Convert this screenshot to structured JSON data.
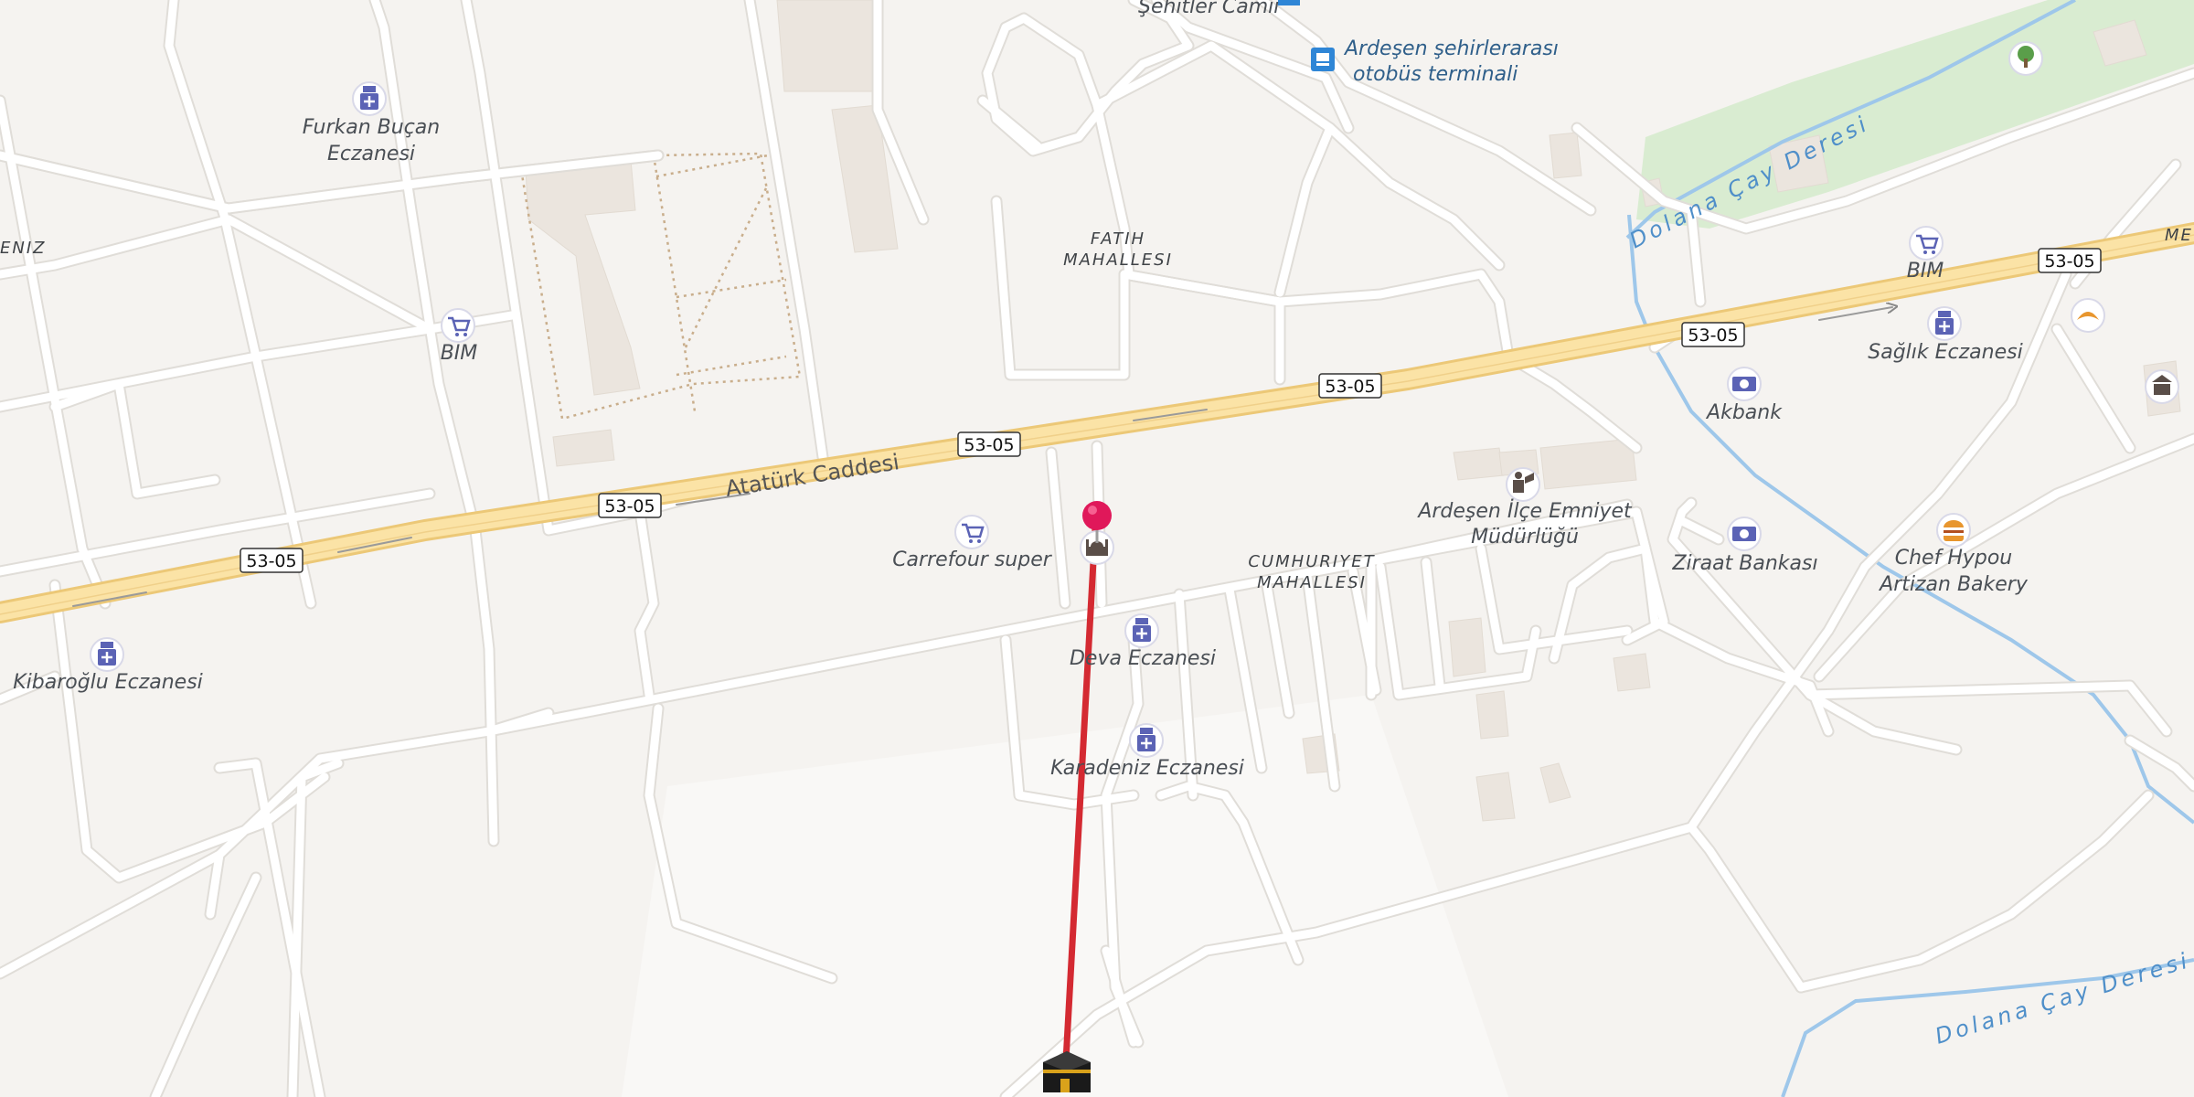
{
  "map": {
    "road_shields": [
      "53-05",
      "53-05",
      "53-05",
      "53-05",
      "53-05",
      "53-05"
    ],
    "streets": [
      "Atatürk Caddesi"
    ],
    "districts": [
      {
        "line1": "FATIH",
        "line2": "MAHALLESI"
      },
      {
        "line1": "CUMHURIYET",
        "line2": "MAHALLESI"
      },
      {
        "line1": "ENIZ",
        "line2": ""
      },
      {
        "line1": "ME",
        "line2": ""
      }
    ],
    "waterways": [
      "Dolana Çay Deresi",
      "Dolana Çay Deresi"
    ],
    "pois": [
      {
        "icon": "pharmacy-icon",
        "line1": "Furkan Buçan",
        "line2": "Eczanesi"
      },
      {
        "icon": "shopping-cart-icon",
        "line1": "BIM",
        "line2": ""
      },
      {
        "icon": "pharmacy-icon",
        "line1": "Kibaroğlu Eczanesi",
        "line2": ""
      },
      {
        "icon": "shopping-cart-icon",
        "line1": "Carrefour super",
        "line2": ""
      },
      {
        "icon": "mosque-icon",
        "line1": "",
        "line2": ""
      },
      {
        "icon": "pharmacy-icon",
        "line1": "Deva Eczanesi",
        "line2": ""
      },
      {
        "icon": "pharmacy-icon",
        "line1": "Karadeniz Eczanesi",
        "line2": ""
      },
      {
        "icon": "police-icon",
        "line1": "Ardeşen İlçe Emniyet",
        "line2": "Müdürlüğü"
      },
      {
        "icon": "bank-icon",
        "line1": "Ziraat Bankası",
        "line2": ""
      },
      {
        "icon": "bank-icon",
        "line1": "Akbank",
        "line2": ""
      },
      {
        "icon": "burger-icon",
        "line1": "Chef Hypou",
        "line2": "Artizan Bakery"
      },
      {
        "icon": "shopping-cart-icon",
        "line1": "BIM",
        "line2": ""
      },
      {
        "icon": "pharmacy-icon",
        "line1": "Sağlık Eczanesi",
        "line2": ""
      },
      {
        "icon": "bus-icon",
        "line1": "Ardeşen şehirlerarası",
        "line2": "otobüs terminali"
      },
      {
        "icon": "mosque-icon",
        "line1": "Şehitler Camii",
        "line2": ""
      },
      {
        "icon": "bakery-icon",
        "line1": "",
        "line2": ""
      },
      {
        "icon": "park-tree-icon",
        "line1": "",
        "line2": ""
      },
      {
        "icon": "museum-icon",
        "line1": "",
        "line2": ""
      }
    ],
    "markers": {
      "pin": "location-pin-icon",
      "kaaba": "kaaba-icon"
    },
    "colors": {
      "background": "#f5f3f0",
      "road": "#ffffff",
      "road_casing": "#e0ddd8",
      "highway": "#fbe3a6",
      "highway_casing": "#ecc877",
      "water": "#9ec7ea",
      "park": "#d9ecd1",
      "building": "#ebe5de",
      "qibla_line": "#d42a32",
      "pin": "#e0185a",
      "poi_icon": "#5b63b5"
    }
  }
}
